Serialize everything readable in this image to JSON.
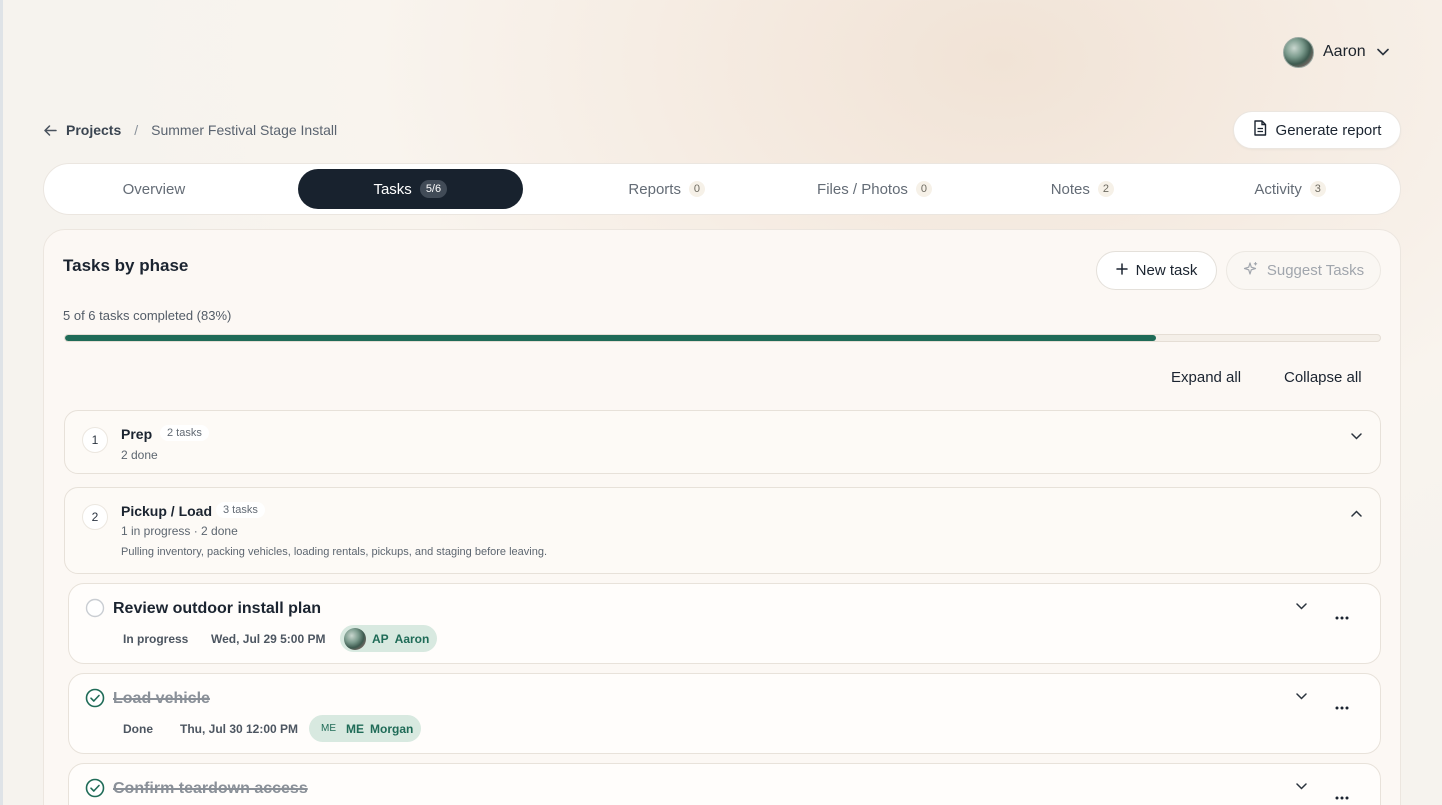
{
  "user": {
    "name": "Aaron"
  },
  "breadcrumb": {
    "root": "Projects",
    "separator": "/",
    "current": "Summer Festival Stage Install"
  },
  "actions": {
    "generate_report": "Generate report"
  },
  "tabs": [
    {
      "label": "Overview",
      "count": ""
    },
    {
      "label": "Tasks",
      "count": "5/6"
    },
    {
      "label": "Reports",
      "count": "0"
    },
    {
      "label": "Files / Photos",
      "count": "0"
    },
    {
      "label": "Notes",
      "count": "2"
    },
    {
      "label": "Activity",
      "count": "3"
    }
  ],
  "panel": {
    "title": "Tasks by phase",
    "new_task": "New task",
    "suggest_tasks": "Suggest Tasks",
    "progress_text": "5 of 6 tasks completed (83%)",
    "progress_fraction": 0.83,
    "expand_all": "Expand all",
    "collapse_all": "Collapse all"
  },
  "phases": [
    {
      "number": "1",
      "name": "Prep",
      "badge": "2 tasks",
      "meta": "2 done",
      "description": ""
    },
    {
      "number": "2",
      "name": "Pickup / Load",
      "badge": "3 tasks",
      "meta": "1 in progress · 2 done",
      "description": "Pulling inventory, packing vehicles, loading rentals, pickups, and staging before leaving."
    }
  ],
  "tasks": [
    {
      "title": "Review outdoor install plan",
      "status": "In progress",
      "date": "Wed, Jul 29 5:00 PM",
      "assignee_initials": "AP",
      "assignee_name": "Aaron"
    },
    {
      "title": "Load vehicle",
      "status": "Done",
      "date": "Thu, Jul 30 12:00 PM",
      "assignee_initials": "ME",
      "assignee_name": "Morgan"
    },
    {
      "title": "Confirm teardown access",
      "status": "",
      "date": "",
      "assignee_initials": "",
      "assignee_name": ""
    }
  ],
  "colors": {
    "accent": "#1f6b57",
    "tab_active": "#18222e",
    "assignee_bg": "#d8e9e0"
  }
}
